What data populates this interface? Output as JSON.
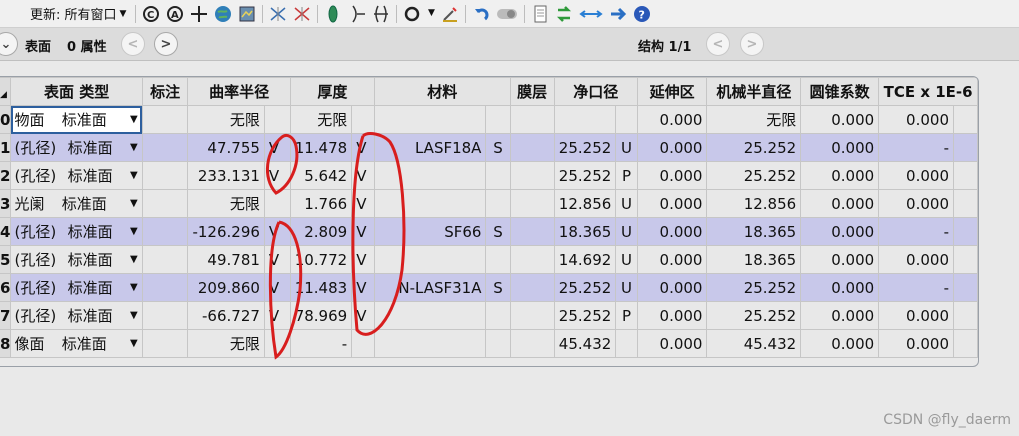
{
  "toolbar": {
    "update_label": "更新: 所有窗口",
    "icons": [
      "refresh-c-icon",
      "refresh-a-icon",
      "crosshair-icon",
      "globe-icon",
      "layout-icon",
      "ray-x-icon",
      "ray-red-icon",
      "lens-green-icon",
      "lens-outline-icon",
      "lens-split-icon",
      "circle-icon",
      "wand-icon",
      "undo-icon",
      "toggle-icon",
      "page-icon",
      "swap-green-icon",
      "arrows-blue-icon",
      "arrow-right-icon",
      "help-icon"
    ]
  },
  "subbar": {
    "surface_label": "表面",
    "props_label": "0 属性",
    "config_label": "结构 1/1"
  },
  "table": {
    "headers": [
      "表面 类型",
      "标注",
      "曲率半径",
      "厚度",
      "材料",
      "膜层",
      "净口径",
      "延伸区",
      "机械半直径",
      "圆锥系数",
      "TCE x 1E-6"
    ],
    "rows": [
      {
        "n": "0",
        "name": "物面",
        "type": "标准面",
        "radius": "无限",
        "rs": "",
        "thickness": "无限",
        "ts": "",
        "material": "",
        "ms": "",
        "clear": "",
        "cs": "",
        "ext": "0.000",
        "mech": "无限",
        "conic": "0.000",
        "tce": "0.000"
      },
      {
        "n": "1",
        "name": "(孔径)",
        "type": "标准面",
        "radius": "47.755",
        "rs": "V",
        "thickness": "11.478",
        "ts": "V",
        "material": "LASF18A",
        "ms": "S",
        "clear": "25.252",
        "cs": "U",
        "ext": "0.000",
        "mech": "25.252",
        "conic": "0.000",
        "tce": "-"
      },
      {
        "n": "2",
        "name": "(孔径)",
        "type": "标准面",
        "radius": "233.131",
        "rs": "V",
        "thickness": "5.642",
        "ts": "V",
        "material": "",
        "ms": "",
        "clear": "25.252",
        "cs": "P",
        "ext": "0.000",
        "mech": "25.252",
        "conic": "0.000",
        "tce": "0.000"
      },
      {
        "n": "3",
        "name": "光阑",
        "type": "标准面",
        "radius": "无限",
        "rs": "",
        "thickness": "1.766",
        "ts": "V",
        "material": "",
        "ms": "",
        "clear": "12.856",
        "cs": "U",
        "ext": "0.000",
        "mech": "12.856",
        "conic": "0.000",
        "tce": "0.000"
      },
      {
        "n": "4",
        "name": "(孔径)",
        "type": "标准面",
        "radius": "-126.296",
        "rs": "V",
        "thickness": "2.809",
        "ts": "V",
        "material": "SF66",
        "ms": "S",
        "clear": "18.365",
        "cs": "U",
        "ext": "0.000",
        "mech": "18.365",
        "conic": "0.000",
        "tce": "-"
      },
      {
        "n": "5",
        "name": "(孔径)",
        "type": "标准面",
        "radius": "49.781",
        "rs": "V",
        "thickness": "10.772",
        "ts": "V",
        "material": "",
        "ms": "",
        "clear": "14.692",
        "cs": "U",
        "ext": "0.000",
        "mech": "18.365",
        "conic": "0.000",
        "tce": "0.000"
      },
      {
        "n": "6",
        "name": "(孔径)",
        "type": "标准面",
        "radius": "209.860",
        "rs": "V",
        "thickness": "11.483",
        "ts": "V",
        "material": "N-LASF31A",
        "ms": "S",
        "clear": "25.252",
        "cs": "U",
        "ext": "0.000",
        "mech": "25.252",
        "conic": "0.000",
        "tce": "-"
      },
      {
        "n": "7",
        "name": "(孔径)",
        "type": "标准面",
        "radius": "-66.727",
        "rs": "V",
        "thickness": "78.969",
        "ts": "V",
        "material": "",
        "ms": "",
        "clear": "25.252",
        "cs": "P",
        "ext": "0.000",
        "mech": "25.252",
        "conic": "0.000",
        "tce": "0.000"
      },
      {
        "n": "8",
        "name": "像面",
        "type": "标准面",
        "radius": "无限",
        "rs": "",
        "thickness": "-",
        "ts": "",
        "material": "",
        "ms": "",
        "clear": "45.432",
        "cs": "",
        "ext": "0.000",
        "mech": "45.432",
        "conic": "0.000",
        "tce": "0.000"
      }
    ]
  },
  "watermark": "CSDN @fly_daerm",
  "colors": {
    "band": "#c8c8ea",
    "annotation": "#d81e1e",
    "select": "#2d5f9e"
  }
}
